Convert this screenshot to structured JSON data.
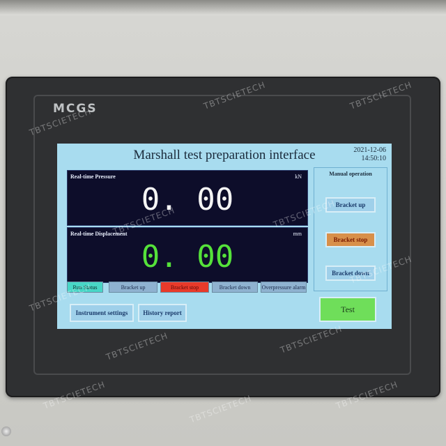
{
  "device": {
    "brand": "MCGS"
  },
  "screen": {
    "title": "Marshall test preparation interface",
    "date": "2021-12-06",
    "time": "14:50:10",
    "pressure": {
      "label": "Real-time Pressure",
      "value": "0. 00",
      "unit": "kN"
    },
    "displacement": {
      "label": "Real-time Displacement",
      "value": "0. 00",
      "unit": "mm"
    },
    "manual": {
      "title": "Manual operation",
      "bracket_up": "Bracket up",
      "bracket_stop": "Bracket stop",
      "bracket_down": "Bracket down"
    },
    "status": {
      "run_status": "Run Status",
      "bracket_up": "Bracket up",
      "bracket_stop": "Bracket stop",
      "bracket_down": "Bracket down",
      "overpressure": "Overpressure alarm"
    },
    "buttons": {
      "instrument_settings": "Instrument settings",
      "history_report": "History report",
      "test": "Test"
    }
  },
  "watermark": "TBTSCIETECH",
  "colors": {
    "screen_bg": "#a8dcef",
    "readout_bg": "#0d0d2a",
    "displacement_value": "#55e23a",
    "stop_indicator": "#e83a2a",
    "test_button": "#6fde5a"
  }
}
